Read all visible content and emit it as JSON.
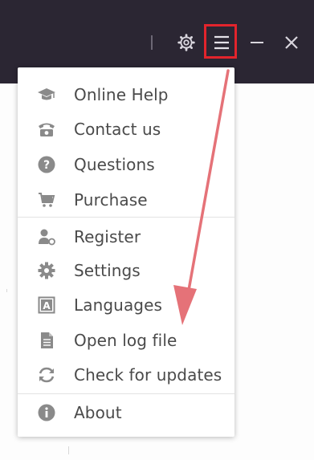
{
  "window": {
    "accent_color": "#2b2633",
    "highlight_color": "#e2242c",
    "arrow_color": "#e57278"
  },
  "titlebar": {
    "settings_icon": "gear-icon",
    "menu_icon": "hamburger-menu-icon",
    "minimize_icon": "minimize-icon",
    "close_icon": "close-icon"
  },
  "menu": {
    "items": [
      {
        "label": "Online Help",
        "icon": "graduation-cap-icon"
      },
      {
        "label": "Contact us",
        "icon": "telephone-icon"
      },
      {
        "label": "Questions",
        "icon": "question-circle-icon"
      },
      {
        "label": "Purchase",
        "icon": "shopping-cart-icon"
      },
      {
        "label": "Register",
        "icon": "user-register-icon"
      },
      {
        "label": "Settings",
        "icon": "gear-icon"
      },
      {
        "label": "Languages",
        "icon": "language-icon"
      },
      {
        "label": "Open log file",
        "icon": "document-icon"
      },
      {
        "label": "Check for updates",
        "icon": "refresh-icon"
      },
      {
        "label": "About",
        "icon": "info-circle-icon"
      }
    ]
  }
}
